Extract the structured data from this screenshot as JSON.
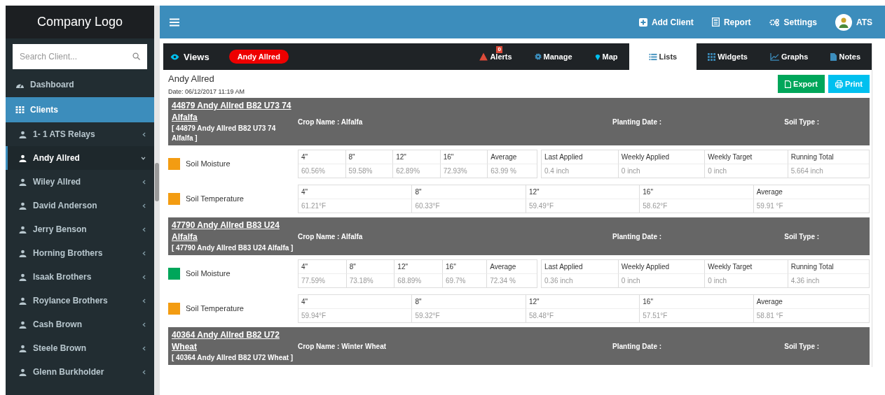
{
  "sidebar": {
    "logo": "Company Logo",
    "search": {
      "placeholder": "Search Client..."
    },
    "nav": [
      {
        "label": "Dashboard",
        "selected": false
      },
      {
        "label": "Clients",
        "selected": true
      }
    ],
    "clients": [
      {
        "label": "1- 1 ATS Relays",
        "selected": false
      },
      {
        "label": "Andy Allred",
        "selected": true
      },
      {
        "label": "Wiley Allred",
        "selected": false
      },
      {
        "label": "David Anderson",
        "selected": false
      },
      {
        "label": "Jerry Benson",
        "selected": false
      },
      {
        "label": "Horning Brothers",
        "selected": false
      },
      {
        "label": "Isaak Brothers",
        "selected": false
      },
      {
        "label": "Roylance Brothers",
        "selected": false
      },
      {
        "label": "Cash Brown",
        "selected": false
      },
      {
        "label": "Steele Brown",
        "selected": false
      },
      {
        "label": "Glenn Burkholder",
        "selected": false
      }
    ]
  },
  "topbar": {
    "actions": [
      "Add Client",
      "Report",
      "Settings"
    ],
    "user": "ATS"
  },
  "views": {
    "title": "Views",
    "client_badge": "Andy Allred",
    "tabs": [
      {
        "label": "Alerts",
        "badge": "0",
        "selected": false
      },
      {
        "label": "Manage",
        "selected": false
      },
      {
        "label": "Map",
        "selected": false
      },
      {
        "label": "Lists",
        "selected": true
      },
      {
        "label": "Widgets",
        "selected": false
      },
      {
        "label": "Graphs",
        "selected": false
      },
      {
        "label": "Notes",
        "selected": false
      }
    ]
  },
  "report": {
    "client": "Andy Allred",
    "date": "Date: 06/12/2017 11:19 AM",
    "buttons": [
      "Export",
      "Print"
    ],
    "fields": [
      {
        "title": "44879 Andy Allred B82 U73 74 Alfalfa",
        "subtitle": "[ 44879 Andy Allred B82 U73 74 Alfalfa ]",
        "crop": "Crop Name : Alfalfa",
        "planting": "Planting Date :",
        "soil": "Soil Type :",
        "sensors": [
          {
            "kind": "moisture",
            "name": "Soil Moisture",
            "color": "#f39c12",
            "depths": [
              {
                "label": "4\"",
                "value": "60.56%"
              },
              {
                "label": "8\"",
                "value": "59.58%"
              },
              {
                "label": "12\"",
                "value": "62.89%"
              },
              {
                "label": "16\"",
                "value": "72.93%"
              },
              {
                "label": "Average",
                "value": "63.99 %"
              }
            ],
            "applied": [
              {
                "label": "Last Applied",
                "value": "0.4 inch"
              },
              {
                "label": "Weekly Applied",
                "value": "0 inch"
              },
              {
                "label": "Weekly Target",
                "value": "0 inch"
              },
              {
                "label": "Running Total",
                "value": "5.664 inch"
              }
            ]
          },
          {
            "kind": "temperature",
            "name": "Soil Temperature",
            "color": "#f39c12",
            "depths": [
              {
                "label": "4\"",
                "value": "61.21°F"
              },
              {
                "label": "8\"",
                "value": "60.33°F"
              },
              {
                "label": "12\"",
                "value": "59.49°F"
              },
              {
                "label": "16\"",
                "value": "58.62°F"
              },
              {
                "label": "Average",
                "value": "59.91 °F"
              }
            ]
          }
        ]
      },
      {
        "title": "47790 Andy Allred B83 U24 Alfalfa",
        "subtitle": "[ 47790 Andy Allred B83 U24 Alfalfa ]",
        "crop": "Crop Name : Alfalfa",
        "planting": "Planting Date :",
        "soil": "Soil Type :",
        "sensors": [
          {
            "kind": "moisture",
            "name": "Soil Moisture",
            "color": "#00a65a",
            "depths": [
              {
                "label": "4\"",
                "value": "77.59%"
              },
              {
                "label": "8\"",
                "value": "73.18%"
              },
              {
                "label": "12\"",
                "value": "68.89%"
              },
              {
                "label": "16\"",
                "value": "69.7%"
              },
              {
                "label": "Average",
                "value": "72.34 %"
              }
            ],
            "applied": [
              {
                "label": "Last Applied",
                "value": "0.36 inch"
              },
              {
                "label": "Weekly Applied",
                "value": "0 inch"
              },
              {
                "label": "Weekly Target",
                "value": "0 inch"
              },
              {
                "label": "Running Total",
                "value": "4.36 inch"
              }
            ]
          },
          {
            "kind": "temperature",
            "name": "Soil Temperature",
            "color": "#f39c12",
            "depths": [
              {
                "label": "4\"",
                "value": "59.94°F"
              },
              {
                "label": "8\"",
                "value": "59.32°F"
              },
              {
                "label": "12\"",
                "value": "58.48°F"
              },
              {
                "label": "16\"",
                "value": "57.51°F"
              },
              {
                "label": "Average",
                "value": "58.81 °F"
              }
            ]
          }
        ]
      },
      {
        "title": "40364 Andy Allred B82 U72 Wheat",
        "subtitle": "[ 40364 Andy Allred B82 U72 Wheat ]",
        "crop": "Crop Name : Winter Wheat",
        "planting": "Planting Date :",
        "soil": "Soil Type :"
      }
    ]
  }
}
